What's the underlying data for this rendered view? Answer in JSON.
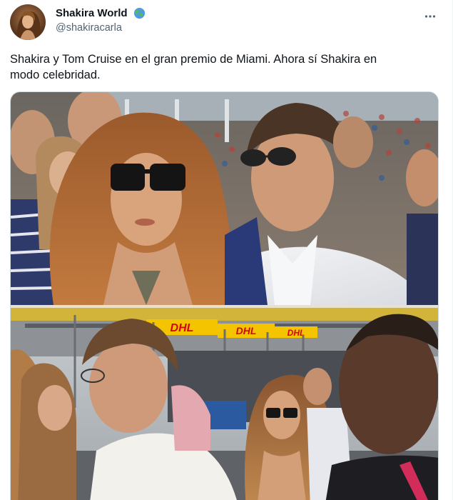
{
  "author": {
    "display_name": "Shakira World",
    "handle": "@shakiracarla",
    "badge_icon": "globe-emoji-icon",
    "avatar_icon": "profile-avatar"
  },
  "tweet": {
    "text": "Shakira y Tom Cruise en el gran premio de Miami. Ahora sí Shakira en\nmodo celebridad."
  },
  "actions": {
    "more_icon": "more-options-icon"
  },
  "media": {
    "banner_text_1": "DHL",
    "banner_text_2": "DHL",
    "banner_text_3": "DHL"
  },
  "colors": {
    "text_primary": "#0f1419",
    "text_secondary": "#536471",
    "border": "#cfd9de",
    "dhl_yellow": "#f4c400",
    "dhl_red": "#d40511"
  }
}
